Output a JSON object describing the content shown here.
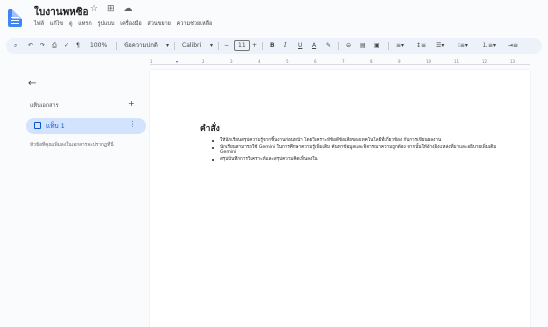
{
  "app": {
    "doc_title": "ใบงานพหซิอ",
    "menu": [
      "ไฟล์",
      "แก้ไข",
      "ดู",
      "แทรก",
      "รูปแบบ",
      "เครื่องมือ",
      "ส่วนขยาย",
      "ความช่วยเหลือ"
    ]
  },
  "toolbar": {
    "zoom": "100%",
    "style": "ข้อความปกติ",
    "font": "Calibri",
    "font_size": "11"
  },
  "sidebar": {
    "outline_label": "แท็บเอกสาร",
    "tab_label": "แท็บ 1",
    "note": "หัวข้อที่คุณเพิ่มลงในเอกสารจะปรากฏที่นี่"
  },
  "document": {
    "heading": "คำสั่ง",
    "bullets": [
      "ให้นักเรียนสรุปความรู้จากชิ้นงานก่อนหน้า โดยวิเคราะห์ข้อดีข้อเสียของเทคโนโลยีที่เกี่ยวข้อง กับการเขียนผลงาน",
      "นักเรียนสามารถใช้ Gemini ในการศึกษาความรู้เพิ่มเติม ค้นหาข้อมูลและพิจารณาความถูกต้อง จากนั้นให้อ้างอิงแหล่งที่มาและอธิบายเพิ่มเติม Gemini",
      "สรุปบันทึกการวิเคราะห์และสรุปความคิดเห็นลงใน"
    ]
  }
}
